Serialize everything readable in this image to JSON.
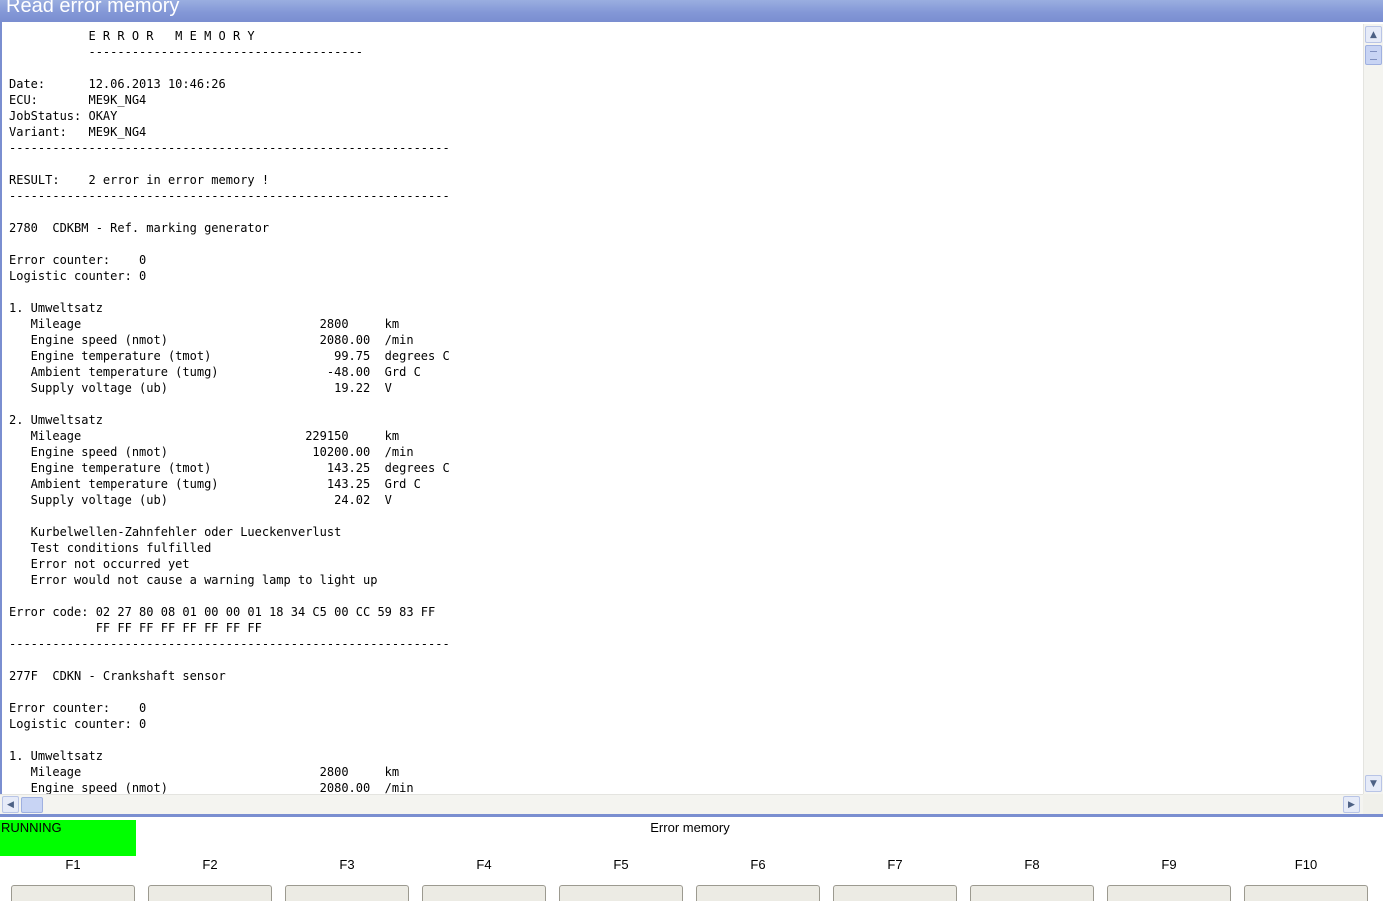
{
  "window": {
    "title": "Read error memory"
  },
  "report_lines": [
    "           E R R O R   M E M O R Y",
    "           --------------------------------------",
    "",
    "Date:      12.06.2013 10:46:26",
    "ECU:       ME9K_NG4",
    "JobStatus: OKAY",
    "Variant:   ME9K_NG4",
    "-------------------------------------------------------------",
    "",
    "RESULT:    2 error in error memory !",
    "-------------------------------------------------------------",
    "",
    "2780  CDKBM - Ref. marking generator",
    "",
    "Error counter:    0",
    "Logistic counter: 0",
    "",
    "1. Umweltsatz",
    "   Mileage                                 2800     km",
    "   Engine speed (nmot)                     2080.00  /min",
    "   Engine temperature (tmot)                 99.75  degrees C",
    "   Ambient temperature (tumg)               -48.00  Grd C",
    "   Supply voltage (ub)                       19.22  V",
    "",
    "2. Umweltsatz",
    "   Mileage                               229150     km",
    "   Engine speed (nmot)                    10200.00  /min",
    "   Engine temperature (tmot)                143.25  degrees C",
    "   Ambient temperature (tumg)               143.25  Grd C",
    "   Supply voltage (ub)                       24.02  V",
    "",
    "   Kurbelwellen-Zahnfehler oder Lueckenverlust",
    "   Test conditions fulfilled",
    "   Error not occurred yet",
    "   Error would not cause a warning lamp to light up",
    "",
    "Error code: 02 27 80 08 01 00 00 01 18 34 C5 00 CC 59 83 FF",
    "            FF FF FF FF FF FF FF FF",
    "-------------------------------------------------------------",
    "",
    "277F  CDKN - Crankshaft sensor",
    "",
    "Error counter:    0",
    "Logistic counter: 0",
    "",
    "1. Umweltsatz",
    "   Mileage                                 2800     km",
    "   Engine speed (nmot)                     2080.00  /min"
  ],
  "status": {
    "state": "RUNNING",
    "state_color": "#00ff00",
    "title": "Error memory"
  },
  "function_keys": [
    {
      "key": "F1",
      "label": ""
    },
    {
      "key": "F2",
      "label": ""
    },
    {
      "key": "F3",
      "label": ""
    },
    {
      "key": "F4",
      "label": ""
    },
    {
      "key": "F5",
      "label": ""
    },
    {
      "key": "F6",
      "label": ""
    },
    {
      "key": "F7",
      "label": ""
    },
    {
      "key": "F8",
      "label": ""
    },
    {
      "key": "F9",
      "label": ""
    },
    {
      "key": "F10",
      "label": ""
    }
  ],
  "icons": {
    "scroll_up": "up-arrow-icon",
    "scroll_down": "down-arrow-icon",
    "scroll_left": "left-arrow-icon",
    "scroll_right": "right-arrow-icon"
  },
  "colors": {
    "title_bar": "#7a8ed0",
    "title_text": "#ffffff"
  }
}
